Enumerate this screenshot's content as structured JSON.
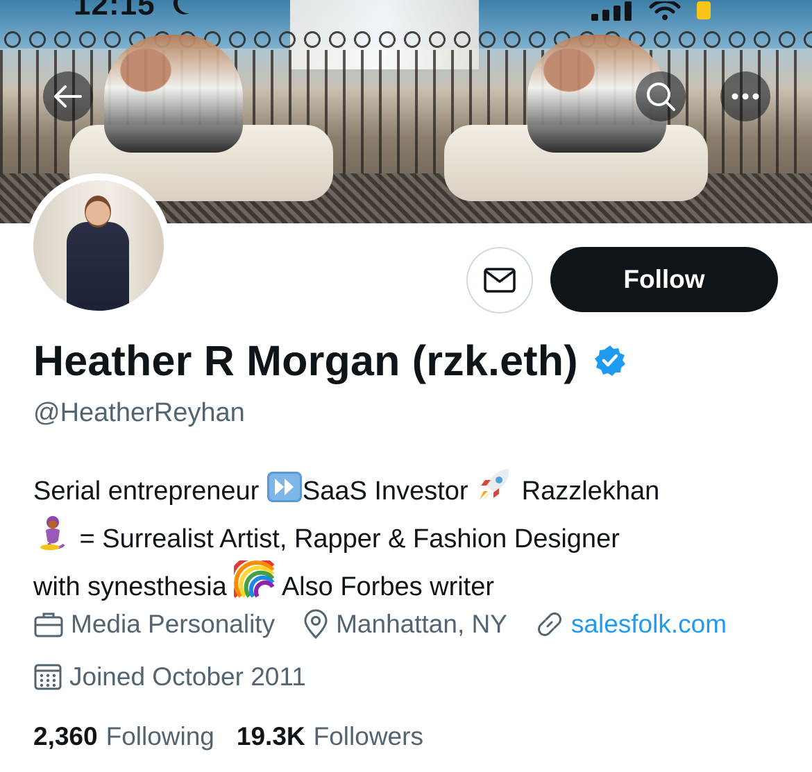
{
  "status_bar": {
    "time": "12:15"
  },
  "header": {
    "back_icon": "arrow-left-icon",
    "search_icon": "search-icon",
    "more_icon": "more-horizontal-icon"
  },
  "actions": {
    "message_icon": "envelope-icon",
    "follow_label": "Follow"
  },
  "profile": {
    "display_name": "Heather R Morgan (rzk.eth)",
    "verified_badge": "verified-badge-icon",
    "handle": "@HeatherReyhan",
    "bio": {
      "line1_a": "Serial entrepreneur ",
      "line1_b": "SaaS Investor ",
      "line1_c": " Razzlekhan",
      "line2": " = Surrealist Artist, Rapper & Fashion Designer",
      "line3_a": "with synesthesia ",
      "line3_b": " Also Forbes writer"
    },
    "category": "Media Personality",
    "location": "Manhattan, NY",
    "website": "salesfolk.com",
    "joined": "Joined October 2011",
    "following_count": "2,360",
    "following_label": "Following",
    "followers_count": "19.3K",
    "followers_label": "Followers"
  },
  "colors": {
    "text_primary": "#0f1419",
    "text_secondary": "#536471",
    "link": "#1d9bf0",
    "verified": "#1d9bf0"
  }
}
